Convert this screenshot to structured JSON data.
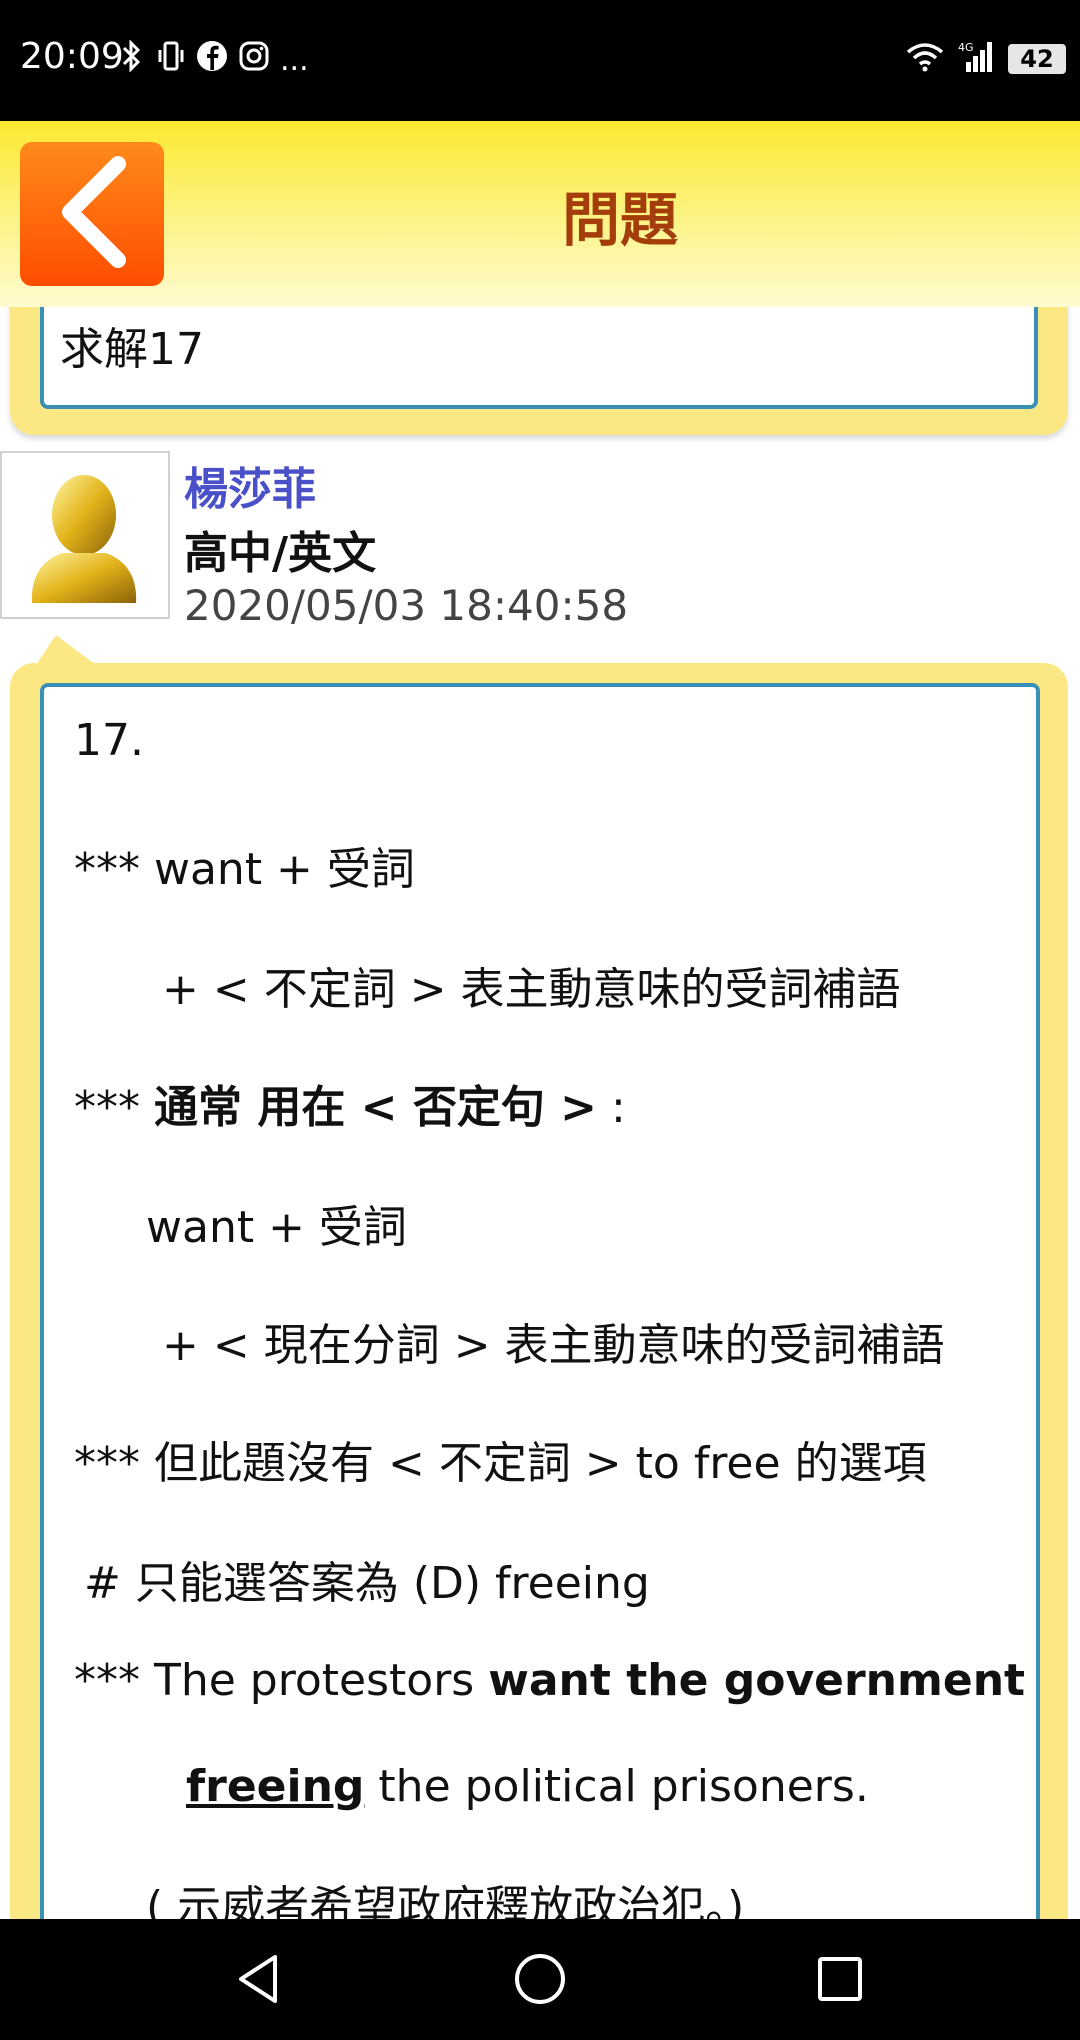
{
  "status_bar": {
    "time": "20:09",
    "more": "...",
    "battery": "42",
    "network": "4G"
  },
  "header": {
    "title": "問題"
  },
  "question": {
    "text": "求解17"
  },
  "answer": {
    "author": "楊莎菲",
    "subject": "高中/英文",
    "datetime": "2020/05/03 18:40:58",
    "lines": {
      "l1": "17.",
      "l2": "*** want + 受詞",
      "l3": "+ < 不定詞 > 表主動意味的受詞補語",
      "l4_prefix": "*** ",
      "l4_bold": "通常 用在 < 否定句 >",
      "l4_suffix": " :",
      "l5": "want + 受詞",
      "l6": "+ < 現在分詞 > 表主動意味的受詞補語",
      "l7": "*** 但此題沒有 < 不定詞 > to free 的選項",
      "l8": "#  只能選答案為 (D) freeing",
      "l9_prefix": "*** The protestors ",
      "l9_bold": "want the government",
      "l10_bold": "freeing",
      "l10_rest": " the political prisoners.",
      "l11": "( 示威者希望政府釋放政治犯。)"
    }
  },
  "colors": {
    "header_yellow": "#fce830",
    "back_orange": "#ff5a00",
    "title_brown": "#a43d0c",
    "card_yellow": "#fbe884",
    "border_blue": "#3a8fb6",
    "author_blue": "#4a50c8"
  },
  "icons": {
    "back": "chevron-left-icon",
    "avatar": "user-avatar-icon",
    "nav_back": "triangle-back-icon",
    "nav_home": "circle-home-icon",
    "nav_recent": "square-recent-icon"
  }
}
